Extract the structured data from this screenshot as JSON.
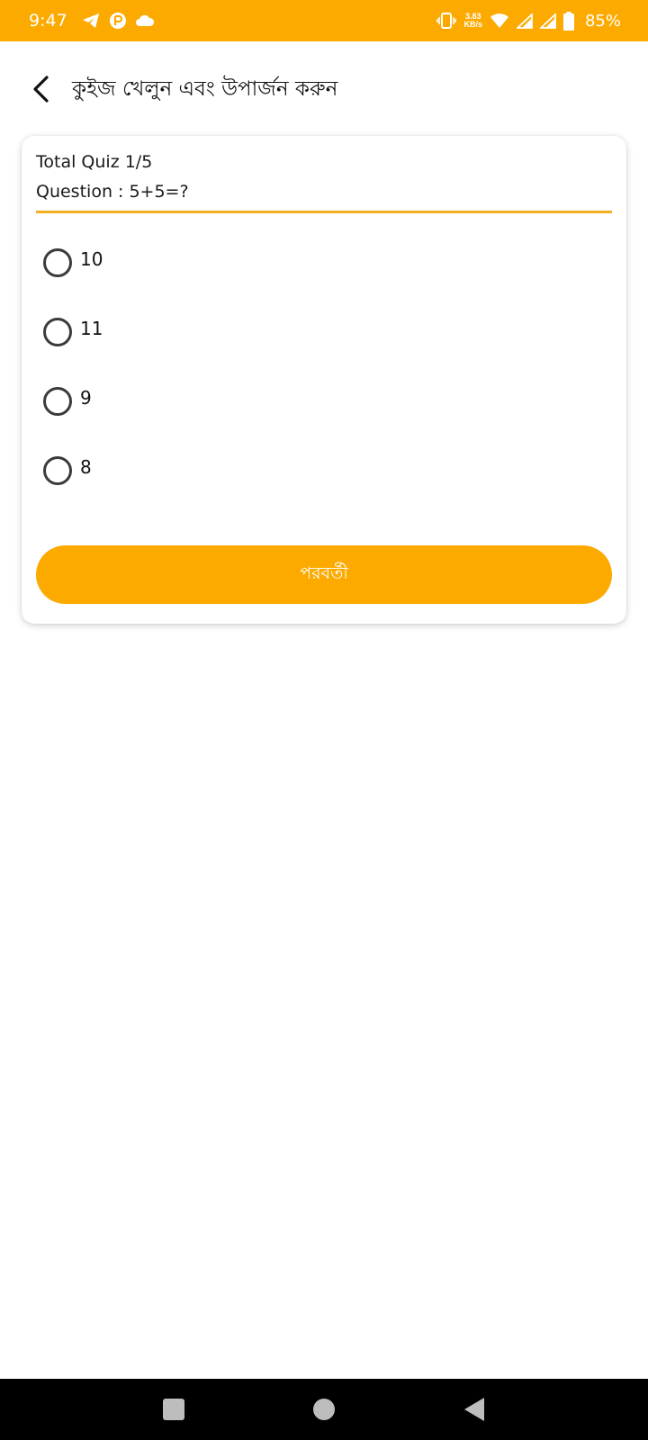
{
  "status_bar": {
    "time": "9:47",
    "net_speed_value": "3.83",
    "net_speed_unit": "KB/s",
    "battery_percent": "85%",
    "icons_left": [
      "telegram-icon",
      "app-badge-icon",
      "cloud-icon"
    ],
    "icons_right": [
      "vibrate-icon",
      "wifi-icon",
      "signal-icon",
      "signal-icon",
      "battery-icon"
    ]
  },
  "app_bar": {
    "title": "কুইজ খেলুন এবং উপার্জন করুন",
    "back_icon": "chevron-left-icon"
  },
  "quiz": {
    "total_label": "Total Quiz 1/5",
    "question_label": "Question : 5+5=?",
    "options": [
      {
        "label": "10",
        "selected": false
      },
      {
        "label": "11",
        "selected": false
      },
      {
        "label": "9",
        "selected": false
      },
      {
        "label": "8",
        "selected": false
      }
    ],
    "next_button_label": "পরবর্তী"
  },
  "colors": {
    "accent": "#FDAA00",
    "divider": "#F0B020",
    "nav_bar": "#000000"
  },
  "nav_bar": {
    "buttons": [
      "recents-icon",
      "home-icon",
      "back-icon"
    ]
  }
}
